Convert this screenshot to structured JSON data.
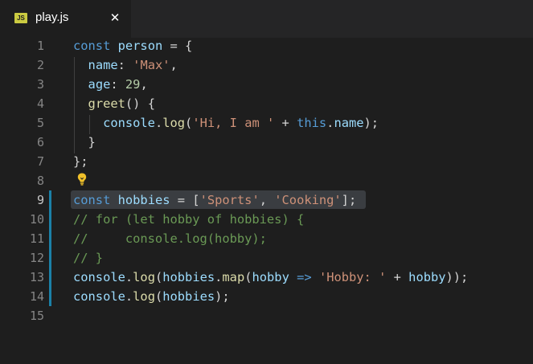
{
  "tab": {
    "badge": "JS",
    "filename": "play.js",
    "close_glyph": "✕"
  },
  "icons": {
    "file_type": "js-file-icon",
    "close": "close-icon",
    "lightbulb": "lightbulb-icon"
  },
  "colors": {
    "keyword": "#569cd6",
    "variable": "#9cdcfe",
    "string": "#ce9178",
    "number": "#b5cea8",
    "function": "#dcdcaa",
    "comment": "#6a9955",
    "gutter_modified": "#1b81a8",
    "js_badge": "#cbcb41"
  },
  "editor": {
    "active_line": 9,
    "lines": [
      {
        "num": "1",
        "tokens": [
          {
            "t": "const",
            "c": "k"
          },
          {
            "t": " ",
            "c": "p"
          },
          {
            "t": "person",
            "c": "v"
          },
          {
            "t": " = {",
            "c": "p"
          }
        ]
      },
      {
        "num": "2",
        "tokens": [
          {
            "t": "  ",
            "c": "p"
          },
          {
            "t": "name",
            "c": "v"
          },
          {
            "t": ": ",
            "c": "p"
          },
          {
            "t": "'Max'",
            "c": "s"
          },
          {
            "t": ",",
            "c": "p"
          }
        ]
      },
      {
        "num": "3",
        "tokens": [
          {
            "t": "  ",
            "c": "p"
          },
          {
            "t": "age",
            "c": "v"
          },
          {
            "t": ": ",
            "c": "p"
          },
          {
            "t": "29",
            "c": "n"
          },
          {
            "t": ",",
            "c": "p"
          }
        ]
      },
      {
        "num": "4",
        "tokens": [
          {
            "t": "  ",
            "c": "p"
          },
          {
            "t": "greet",
            "c": "f"
          },
          {
            "t": "() {",
            "c": "p"
          }
        ]
      },
      {
        "num": "5",
        "tokens": [
          {
            "t": "    ",
            "c": "p"
          },
          {
            "t": "console",
            "c": "v"
          },
          {
            "t": ".",
            "c": "p"
          },
          {
            "t": "log",
            "c": "f"
          },
          {
            "t": "(",
            "c": "p"
          },
          {
            "t": "'Hi, I am '",
            "c": "s"
          },
          {
            "t": " + ",
            "c": "p"
          },
          {
            "t": "this",
            "c": "k"
          },
          {
            "t": ".",
            "c": "p"
          },
          {
            "t": "name",
            "c": "v"
          },
          {
            "t": ");",
            "c": "p"
          }
        ]
      },
      {
        "num": "6",
        "tokens": [
          {
            "t": "  }",
            "c": "p"
          }
        ]
      },
      {
        "num": "7",
        "tokens": [
          {
            "t": "};",
            "c": "p"
          }
        ]
      },
      {
        "num": "8",
        "tokens": []
      },
      {
        "num": "9",
        "tokens": [
          {
            "t": "const",
            "c": "k"
          },
          {
            "t": " ",
            "c": "p"
          },
          {
            "t": "hobbies",
            "c": "v"
          },
          {
            "t": " = [",
            "c": "p"
          },
          {
            "t": "'Sports'",
            "c": "s"
          },
          {
            "t": ", ",
            "c": "p"
          },
          {
            "t": "'Cooking'",
            "c": "s"
          },
          {
            "t": "];",
            "c": "p"
          }
        ]
      },
      {
        "num": "10",
        "tokens": [
          {
            "t": "// for (let hobby of hobbies) {",
            "c": "c"
          }
        ]
      },
      {
        "num": "11",
        "tokens": [
          {
            "t": "//     console.log(hobby);",
            "c": "c"
          }
        ]
      },
      {
        "num": "12",
        "tokens": [
          {
            "t": "// }",
            "c": "c"
          }
        ]
      },
      {
        "num": "13",
        "tokens": [
          {
            "t": "console",
            "c": "v"
          },
          {
            "t": ".",
            "c": "p"
          },
          {
            "t": "log",
            "c": "f"
          },
          {
            "t": "(",
            "c": "p"
          },
          {
            "t": "hobbies",
            "c": "v"
          },
          {
            "t": ".",
            "c": "p"
          },
          {
            "t": "map",
            "c": "f"
          },
          {
            "t": "(",
            "c": "p"
          },
          {
            "t": "hobby",
            "c": "v"
          },
          {
            "t": " ",
            "c": "p"
          },
          {
            "t": "=>",
            "c": "k"
          },
          {
            "t": " ",
            "c": "p"
          },
          {
            "t": "'Hobby: '",
            "c": "s"
          },
          {
            "t": " + ",
            "c": "p"
          },
          {
            "t": "hobby",
            "c": "v"
          },
          {
            "t": "));",
            "c": "p"
          }
        ]
      },
      {
        "num": "14",
        "tokens": [
          {
            "t": "console",
            "c": "v"
          },
          {
            "t": ".",
            "c": "p"
          },
          {
            "t": "log",
            "c": "f"
          },
          {
            "t": "(",
            "c": "p"
          },
          {
            "t": "hobbies",
            "c": "v"
          },
          {
            "t": ");",
            "c": "p"
          }
        ]
      },
      {
        "num": "15",
        "tokens": []
      }
    ]
  }
}
